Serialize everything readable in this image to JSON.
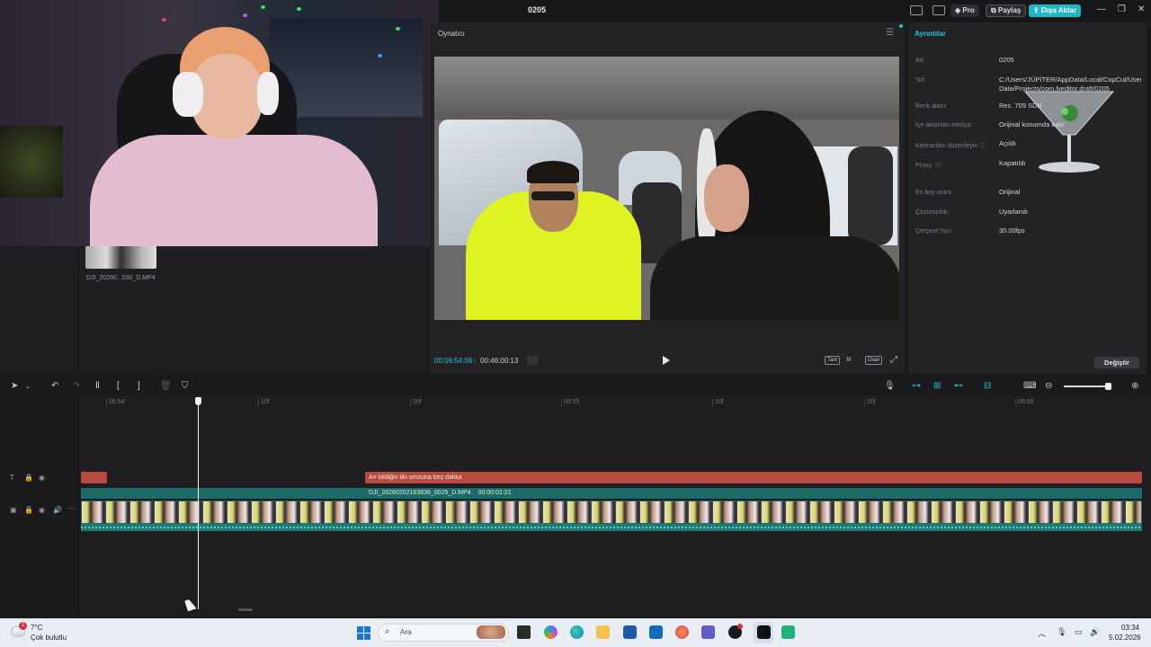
{
  "window": {
    "title": "0205"
  },
  "header_buttons": {
    "pro": "◈ Pro",
    "share": "⧉ Paylaş",
    "export": "⇪ Dışa Aktar"
  },
  "window_controls": {
    "minimize": "—",
    "maximize": "❐",
    "close": "✕"
  },
  "media": {
    "clip_name": "DJI_20260...030_D.MP4"
  },
  "player": {
    "title": "Oynatıcı",
    "current_time": "00:06:54:06",
    "total_time": "00:46:00:13",
    "full_label": "Tam",
    "ratio_label": "Oran"
  },
  "details": {
    "title": "Ayrıntılar",
    "rows": [
      {
        "label": "Ad:",
        "value": "0205"
      },
      {
        "label": "Yol:",
        "value": "C:/Users/JÜPİTER/AppData/Local/CapCut/User Data/Projects/com.lveditor.draft/0205"
      },
      {
        "label": "Renk alanı:",
        "value": "Rec. 709 SDR"
      },
      {
        "label": "İçe aktarılan medya:",
        "value": "Orijinal konumda kalır"
      },
      {
        "label": "Katmanları düzenleyin ⓘ",
        "value": "Açıldı"
      },
      {
        "label": "Proxy: ⓘ",
        "value": "Kapatıldı"
      },
      {
        "label": "En boy oranı:",
        "value": "Orijinal"
      },
      {
        "label": "Çözünürlük:",
        "value": "Uyarlandı"
      },
      {
        "label": "Çerçeve hızı:",
        "value": "30.00fps"
      }
    ],
    "modify_button": "Değiştir"
  },
  "timeline": {
    "ruler": [
      "06:54",
      "10f",
      "20f",
      "06:55",
      "10f",
      "20f",
      "06:56"
    ],
    "text_clip_label": "A≡ bildiğin tiki omzuna beş dakka",
    "video_clip_name": "DJI_20260202163836_0025_D.MP4",
    "video_clip_duration": "00:00:01:21"
  },
  "taskbar": {
    "weather_badge": "2",
    "temperature": "7°C",
    "weather_desc": "Çok bulutlu",
    "search_placeholder": "Ara",
    "time": "03:34",
    "date": "5.02.2026"
  },
  "colors": {
    "accent": "#1fc5d8",
    "text_clip": "#b84a40",
    "video_track": "#1c6b66"
  }
}
